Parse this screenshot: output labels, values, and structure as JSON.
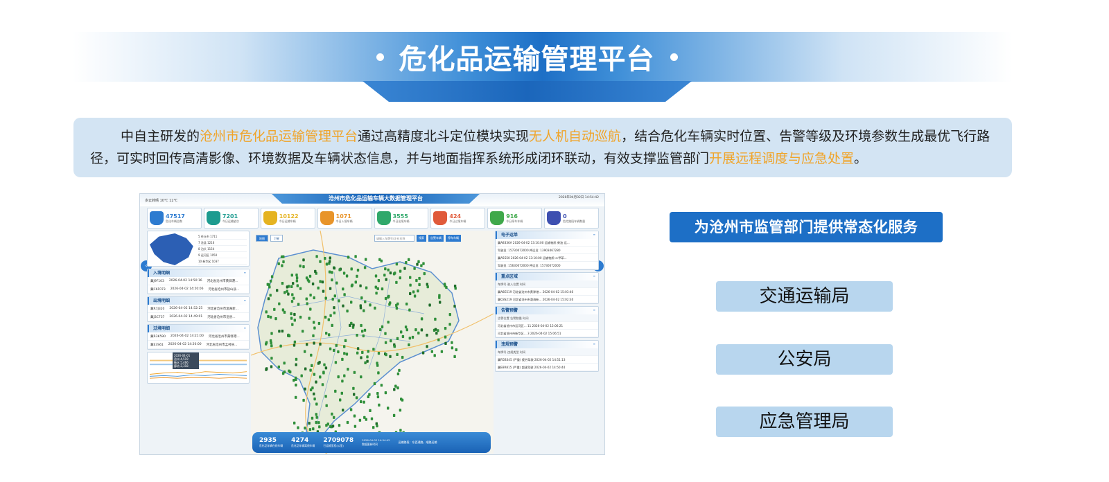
{
  "header": {
    "title": "危化品运输管理平台"
  },
  "description": {
    "p1": "中自主研发的",
    "h1": "沧州市危化品运输管理平台",
    "p2": "通过高精度北斗定位模块实现",
    "h2": "无人机自动巡航",
    "p3": "，结合危化车辆实时位置、告警等级及环境参数生成最优飞行路径，可实时回传高清影像、环境数据及车辆状态信息，并与地面指挥系统形成闭环联动，有效支撑监管部门",
    "h3": "开展远程调度与应急处置",
    "p4": "。",
    "highlight_color": "#f0a429"
  },
  "dashboard": {
    "title": "沧州市危化品运输车辆大数据管理平台",
    "weather": "多云转晴 10℃ 12℃",
    "datetime": "2026年04月02日 14:54:42",
    "stats": [
      {
        "value": "47517",
        "label": "危化车辆总数",
        "color": "#2d7bd0",
        "icon": "truck-icon"
      },
      {
        "value": "7201",
        "label": "今日运输趟次",
        "color": "#1d9b8f",
        "icon": "truck-icon"
      },
      {
        "value": "10122",
        "label": "今日运输车辆",
        "color": "#e5b321",
        "icon": "truck-icon"
      },
      {
        "value": "1071",
        "label": "今日入境车辆",
        "color": "#e8942a",
        "icon": "truck-icon"
      },
      {
        "value": "3555",
        "label": "今日出境车辆",
        "color": "#2fa86a",
        "icon": "truck-icon"
      },
      {
        "value": "424",
        "label": "今日过境车辆",
        "color": "#e05a3a",
        "icon": "truck-icon"
      },
      {
        "value": "916",
        "label": "今日停车车辆",
        "color": "#3fa84a",
        "icon": "truck-icon"
      },
      {
        "value": "0",
        "label": "危险路段车辆数量",
        "color": "#3d4fb0",
        "icon": "truck-icon"
      }
    ],
    "region_table": [
      {
        "rank": "5",
        "name": "任丘市",
        "count": "1711"
      },
      {
        "rank": "7",
        "name": "沧县",
        "count": "1216"
      },
      {
        "rank": "8",
        "name": "泊头",
        "count": "1154"
      },
      {
        "rank": "9",
        "name": "运河区",
        "count": "1050"
      },
      {
        "rank": "10",
        "name": "新华区",
        "count": "1037"
      }
    ],
    "panels_left": [
      {
        "title": "入境明细",
        "rows": [
          [
            "冀J9F103",
            "2026-04-02 14:50:16",
            "河北省沧州市黄骅港..."
          ],
          [
            "冀C6F073",
            "2026-04-02 14:50:06",
            "河北省沧州市盐山县..."
          ]
        ]
      },
      {
        "title": "出境明细",
        "rows": [
          [
            "冀R7J320",
            "2026-04-02 14:52:25",
            "河北省沧州市渤海新..."
          ],
          [
            "冀J3C737",
            "2026-04-02 14:49:01",
            "河北省沧州市沧县..."
          ]
        ]
      },
      {
        "title": "过境明细",
        "rows": [
          [
            "冀R3K590",
            "2026-04-02 14:21:00",
            "河北省沧州市黄骅港..."
          ],
          [
            "冀E3S61",
            "2026-04-02 14:20:00",
            "河北省沧州市孟村县..."
          ]
        ]
      }
    ],
    "chart_tip": [
      "2026-04-01",
      "沧州 4,519",
      "衡水 5,466",
      "廊坊 2,318"
    ],
    "chart_legend": [
      "沧州",
      "衡水",
      "廊坊"
    ],
    "map": {
      "tabs": [
        "地图",
        "卫星"
      ],
      "search_placeholder": "请输入车牌号/企业名称",
      "buttons": [
        "搜索",
        "告警车辆",
        "停车车辆"
      ]
    },
    "bottom": [
      {
        "value": "2935",
        "label": "危化品车辆在线车辆"
      },
      {
        "value": "4274",
        "label": "危化品车辆离线车辆"
      },
      {
        "value": "2709078",
        "label": "已运输里程(公里)"
      },
      {
        "value": "2026-04-02 14:54:42",
        "label": "数据更新时间"
      }
    ],
    "bottom_note": "运输路段：东西通路，顺路运输",
    "right_panels": [
      {
        "title": "电子运单",
        "rows": [
          "冀A8336A  2026-04-02 13:10:00  运输物质:柴油  运...",
          "驾驶员: 15730072000  押运员: 13903467280",
          "冀A5S50  2026-04-02 13:10:00  运输物质:二甲苯...",
          "驾驶员: 15630072000  押运员: 15730072000"
        ]
      },
      {
        "title": "重点区域",
        "head": "车牌号  驶入位置  时间",
        "rows": [
          "冀A8E519  河北省沧州市黄骅港...  2026-04-02 15:03:46",
          "冀C8S219  河北省沧州市渤海新...  2026-04-02 15:02:30"
        ]
      },
      {
        "title": "告警预警",
        "head": "告警位置  告警数量  时间",
        "rows": [
          "河北省沧州市运河区...  11  2026-04-02 15:06:21",
          "河北省沧州市新华区...  3  2026-04-02 15:06:51"
        ]
      },
      {
        "title": "违规预警",
        "head": "车牌号  违规类型  时间",
        "rows": [
          "冀R5B345  (严重) 疲劳驾驶  2026-04-02 14:51:13",
          "冀E8R815  (严重) 超速驾驶  2026-04-02 14:50:44"
        ]
      }
    ]
  },
  "services": {
    "title": "为沧州市监管部门提供常态化服务",
    "items": [
      "交通运输局",
      "公安局",
      "应急管理局"
    ]
  }
}
